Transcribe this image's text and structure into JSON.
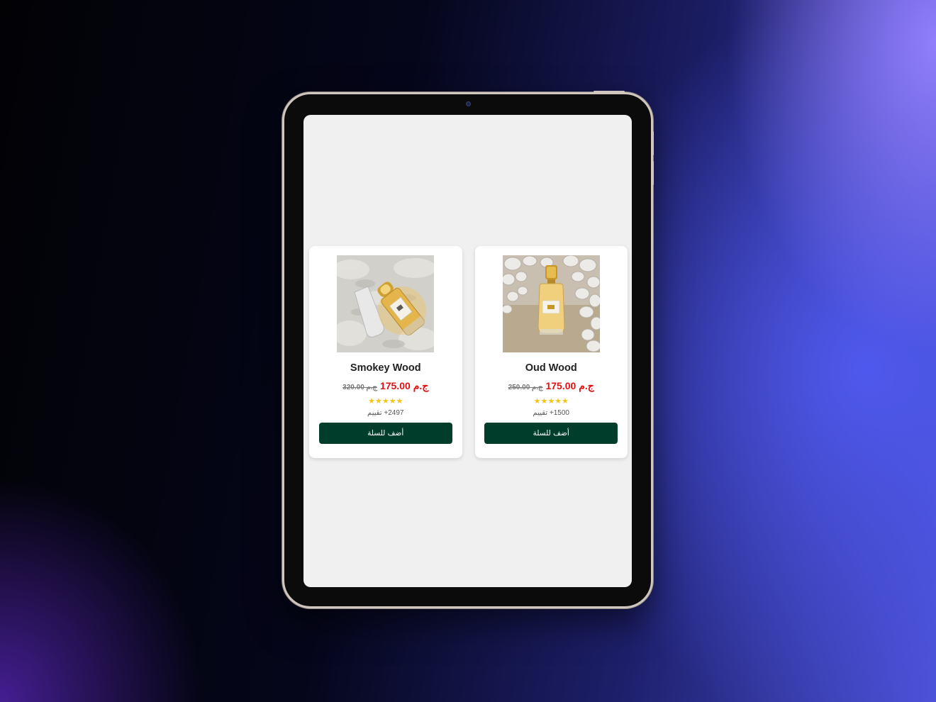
{
  "products": [
    {
      "name": "Oud Wood",
      "image_icon": "perfume-bottle-pebbles-image",
      "currency": "ج.م",
      "price": "175.00",
      "old_price": "250.00",
      "rating_stars": "★★★★★",
      "rating": 5,
      "reviews": "1500+ تقييم",
      "button_label": "أضف للسلة"
    },
    {
      "name": "Smokey Wood",
      "image_icon": "perfume-bottle-powder-image",
      "currency": "ج.م",
      "price": "175.00",
      "old_price": "320.00",
      "rating_stars": "★★★★★",
      "rating": 5,
      "reviews": "2497+ تقييم",
      "button_label": "أضف للسلة"
    }
  ],
  "colors": {
    "button_bg": "#003d2b",
    "sale_price": "#e01010",
    "star": "#f5c518"
  }
}
